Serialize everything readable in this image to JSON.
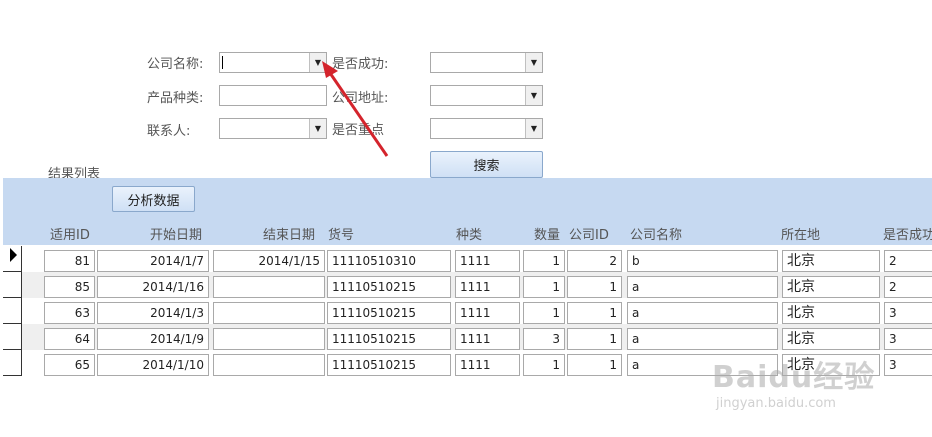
{
  "filters": {
    "company_name_label": "公司名称:",
    "product_type_label": "产品种类:",
    "contact_label": "联系人:",
    "success_label": "是否成功:",
    "address_label": "公司地址:",
    "key_label": "是否重点",
    "search_button": "搜索"
  },
  "results": {
    "title": "结果列表",
    "analyze_button": "分析数据",
    "columns": [
      "适用ID",
      "开始日期",
      "结束日期",
      "货号",
      "种类",
      "数量",
      "公司ID",
      "公司名称",
      "所在地",
      "是否成功"
    ],
    "rows": [
      {
        "id": "81",
        "start": "2014/1/7",
        "end": "2014/1/15",
        "item_no": "11110510310",
        "kind": "1111",
        "qty": "1",
        "company_id": "2",
        "company_name": "b",
        "location": "北京",
        "success": "2"
      },
      {
        "id": "85",
        "start": "2014/1/16",
        "end": "",
        "item_no": "11110510215",
        "kind": "1111",
        "qty": "1",
        "company_id": "1",
        "company_name": "a",
        "location": "北京",
        "success": "2"
      },
      {
        "id": "63",
        "start": "2014/1/3",
        "end": "",
        "item_no": "11110510215",
        "kind": "1111",
        "qty": "1",
        "company_id": "1",
        "company_name": "a",
        "location": "北京",
        "success": "3"
      },
      {
        "id": "64",
        "start": "2014/1/9",
        "end": "",
        "item_no": "11110510215",
        "kind": "1111",
        "qty": "3",
        "company_id": "1",
        "company_name": "a",
        "location": "北京",
        "success": "3"
      },
      {
        "id": "65",
        "start": "2014/1/10",
        "end": "",
        "item_no": "11110510215",
        "kind": "1111",
        "qty": "1",
        "company_id": "1",
        "company_name": "a",
        "location": "北京",
        "success": "3"
      }
    ]
  },
  "watermark": {
    "text": "Baidu经验",
    "url": "jingyan.baidu.com"
  },
  "colors": {
    "header_band": "#c6d9f1",
    "alt_row": "#efefef",
    "annotation_arrow": "#d4242c"
  }
}
